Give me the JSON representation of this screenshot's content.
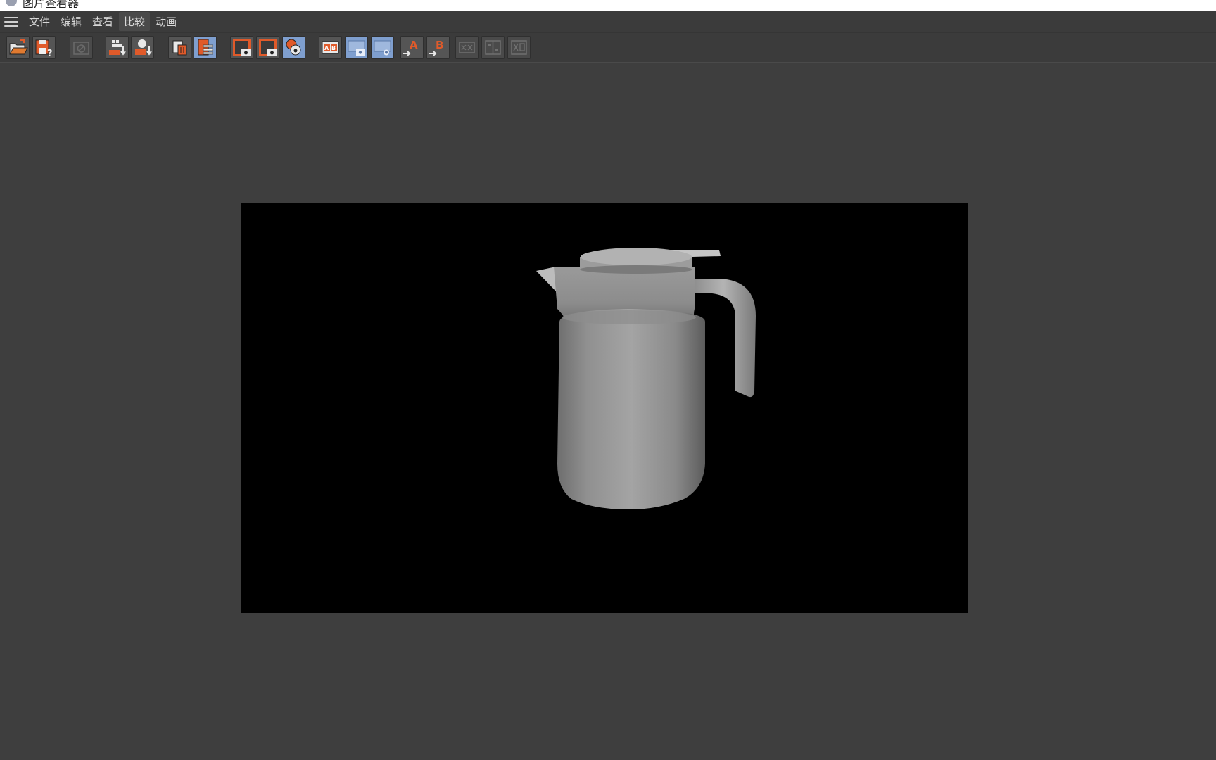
{
  "window": {
    "title": "图片查看器"
  },
  "menu": {
    "items": [
      {
        "label": "文件"
      },
      {
        "label": "编辑"
      },
      {
        "label": "查看"
      },
      {
        "label": "比较"
      },
      {
        "label": "动画"
      }
    ]
  },
  "toolbar": {
    "buttons": [
      {
        "name": "open-icon"
      },
      {
        "name": "save-as-icon"
      },
      {
        "name": "stop-render-icon",
        "state": "disabled"
      },
      {
        "name": "zoom-fit-icon"
      },
      {
        "name": "export-snapshot-icon"
      },
      {
        "name": "delete-image-icon"
      },
      {
        "name": "history-list-icon",
        "state": "active"
      },
      {
        "name": "view-channel-a-icon"
      },
      {
        "name": "view-channel-b-icon"
      },
      {
        "name": "view-overlay-icon",
        "state": "active"
      },
      {
        "name": "ab-compare-icon"
      },
      {
        "name": "ab-compare-view-a-icon",
        "state": "active"
      },
      {
        "name": "ab-compare-view-b-icon",
        "state": "active"
      },
      {
        "name": "set-as-a-icon"
      },
      {
        "name": "set-as-b-icon"
      },
      {
        "name": "swap-ab-icon",
        "state": "disabled"
      },
      {
        "name": "split-view-icon",
        "state": "disabled"
      },
      {
        "name": "difference-view-icon",
        "state": "disabled"
      }
    ],
    "set_a_label": "A",
    "set_b_label": "B",
    "ab_label": "AB"
  },
  "viewport": {
    "image_subject": "kettle-render",
    "background_color": "#3e3e3e",
    "image_background": "#000000"
  },
  "colors": {
    "accent": "#e05a2a",
    "active_blue": "#7f9fcf",
    "menubar": "#3b3b3b"
  }
}
